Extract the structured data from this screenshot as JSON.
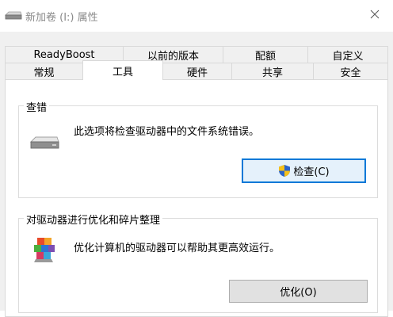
{
  "window": {
    "title": "新加卷 (I:) 属性",
    "close_glyph": "✕"
  },
  "tabs": {
    "row1": [
      {
        "label": "ReadyBoost"
      },
      {
        "label": "以前的版本"
      },
      {
        "label": "配额"
      },
      {
        "label": "自定义"
      }
    ],
    "row2": [
      {
        "label": "常规"
      },
      {
        "label": "工具"
      },
      {
        "label": "硬件"
      },
      {
        "label": "共享"
      },
      {
        "label": "安全"
      }
    ],
    "active": "工具"
  },
  "error_checking": {
    "title": "查错",
    "description": "此选项将检查驱动器中的文件系统错误。",
    "button_label": "检查(C)",
    "icon": "drive-icon"
  },
  "optimize": {
    "title": "对驱动器进行优化和碎片整理",
    "description": "优化计算机的驱动器可以帮助其更高效运行。",
    "button_label": "优化(O)",
    "icon": "defrag-icon"
  },
  "colors": {
    "accent": "#0078d7",
    "panel_bg": "#ffffff",
    "dialog_bg": "#f0f0f0"
  }
}
